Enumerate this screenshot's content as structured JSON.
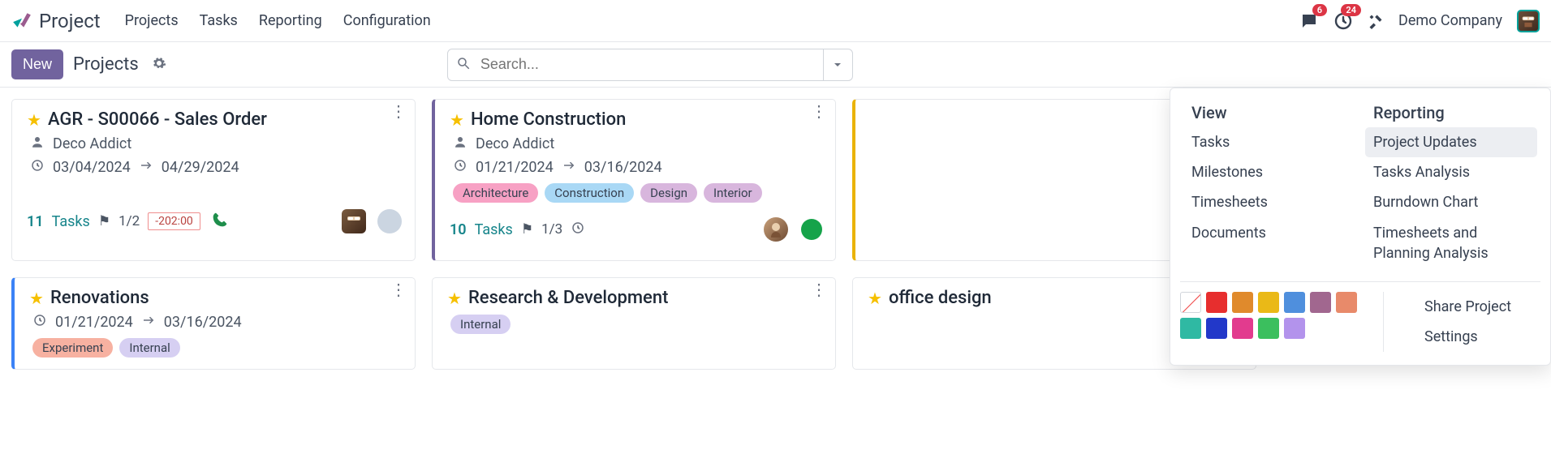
{
  "app_name": "Project",
  "nav": {
    "projects": "Projects",
    "tasks": "Tasks",
    "reporting": "Reporting",
    "configuration": "Configuration"
  },
  "top": {
    "badge_msg": "6",
    "badge_act": "24",
    "company": "Demo Company"
  },
  "toolbar": {
    "new_label": "New",
    "breadcrumb": "Projects"
  },
  "search": {
    "placeholder": "Search..."
  },
  "cards": {
    "agr": {
      "title": "AGR - S00066 - Sales Order",
      "client": "Deco Addict",
      "date_start": "03/04/2024",
      "date_end": "04/29/2024",
      "tasks_n": "11",
      "tasks_label": "Tasks",
      "milestone": "1/2",
      "time": "-202:00"
    },
    "home": {
      "title": "Home Construction",
      "client": "Deco Addict",
      "date_start": "01/21/2024",
      "date_end": "03/16/2024",
      "tags": {
        "t0": "Architecture",
        "t1": "Construction",
        "t2": "Design",
        "t3": "Interior"
      },
      "tasks_n": "10",
      "tasks_label": "Tasks",
      "milestone": "1/3"
    },
    "reno": {
      "title": "Renovations",
      "date_start": "01/21/2024",
      "date_end": "03/16/2024",
      "tags": {
        "t0": "Experiment",
        "t1": "Internal"
      }
    },
    "rnd": {
      "title": "Research & Development",
      "tags": {
        "t0": "Internal"
      }
    },
    "office": {
      "title": "office design"
    }
  },
  "panel": {
    "view_header": "View",
    "view": {
      "tasks": "Tasks",
      "milestones": "Milestones",
      "timesheets": "Timesheets",
      "documents": "Documents"
    },
    "report_header": "Reporting",
    "report": {
      "updates": "Project Updates",
      "tasks_analysis": "Tasks Analysis",
      "burndown": "Burndown Chart",
      "ts_plan": "Timesheets and Planning Analysis"
    },
    "share": "Share Project",
    "settings": "Settings"
  },
  "colors": {
    "c1": "#e72e2e",
    "c2": "#e08a2c",
    "c3": "#eab917",
    "c4": "#4f8fdd",
    "c5": "#a1678f",
    "c6": "#e88a6a",
    "c7": "#2fb9a3",
    "c8": "#2238c9",
    "c9": "#e23b8e",
    "c10": "#3bbf5e",
    "c11": "#b393ec"
  },
  "tag_colors": {
    "arch": "#f7a1c4",
    "constr": "#a9d8f5",
    "design": "#d8b6dd",
    "interior": "#d8b6dd",
    "experiment": "#f7b1a1",
    "internal": "#d6cff2"
  }
}
